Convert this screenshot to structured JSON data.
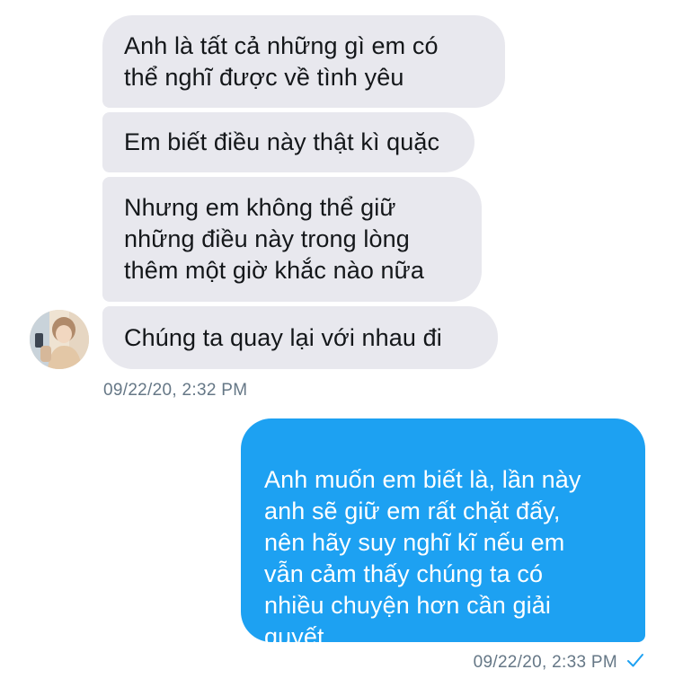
{
  "conversation": {
    "incoming": [
      {
        "text": "Anh là tất cả những gì em có\nthể nghĩ được về tình yêu"
      },
      {
        "text": "Em biết điều này thật kì quặc"
      },
      {
        "text": "Nhưng em không thể giữ\nnhững điều này trong lòng\nthêm một giờ khắc nào nữa"
      },
      {
        "text": "Chúng ta quay lại với nhau đi"
      }
    ],
    "incoming_timestamp": "09/22/20, 2:32 PM",
    "outgoing": [
      {
        "text": "Anh muốn em biết là, lần này\nanh sẽ giữ em rất chặt đấy,\nnên hãy suy nghĩ kĩ nếu em\nvẫn cảm thấy chúng ta có\nnhiều chuyện hơn cần giải\nquyết"
      }
    ],
    "outgoing_timestamp": "09/22/20, 2:33 PM"
  },
  "icons": {
    "avatar": "contact-avatar",
    "status": "checkmark-icon"
  },
  "colors": {
    "incoming_bubble": "#e8e8ee",
    "outgoing_bubble": "#1da1f2",
    "timestamp": "#657786"
  }
}
